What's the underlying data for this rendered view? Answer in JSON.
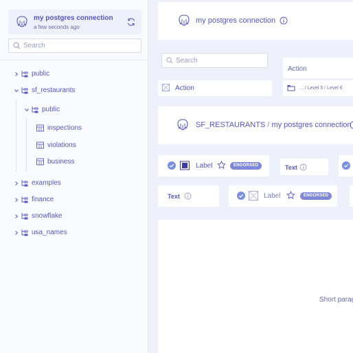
{
  "sidebar": {
    "connection": {
      "title": "my postgres connection",
      "subtitle": "a few seconds ago"
    },
    "search": {
      "placeholder": "Search"
    },
    "tree": [
      {
        "label": "public",
        "expanded": false
      },
      {
        "label": "sf_restaurants",
        "expanded": true,
        "children": [
          {
            "label": "public",
            "expanded": true,
            "tables": [
              "inspections",
              "violations",
              "business"
            ]
          }
        ]
      },
      {
        "label": "examples",
        "expanded": false
      },
      {
        "label": "finance",
        "expanded": false
      },
      {
        "label": "snowflake",
        "expanded": false
      },
      {
        "label": "usa_names",
        "expanded": false
      }
    ]
  },
  "main": {
    "header": {
      "title": "my postgres connection"
    },
    "search": {
      "placeholder": "Search"
    },
    "action_top": "Action",
    "action_left": "Action",
    "breadcrumb": "... / Level 5 / Level 6",
    "db_header": {
      "database": "SF_RESTAURANTS",
      "separator": "/",
      "connection": "my postgres connection"
    },
    "label_item_1": {
      "label": "Label",
      "badge": "ENDORSED"
    },
    "label_item_2": {
      "label": "Label",
      "badge": "ENDORSED"
    },
    "text_1": "Text",
    "text_2": "Text",
    "paragraph": "Short paragraph"
  },
  "colors": {
    "accent": "#5555c8",
    "background": "#eef0fb",
    "badge": "#7f88d8",
    "check": "#7b8fe0"
  }
}
